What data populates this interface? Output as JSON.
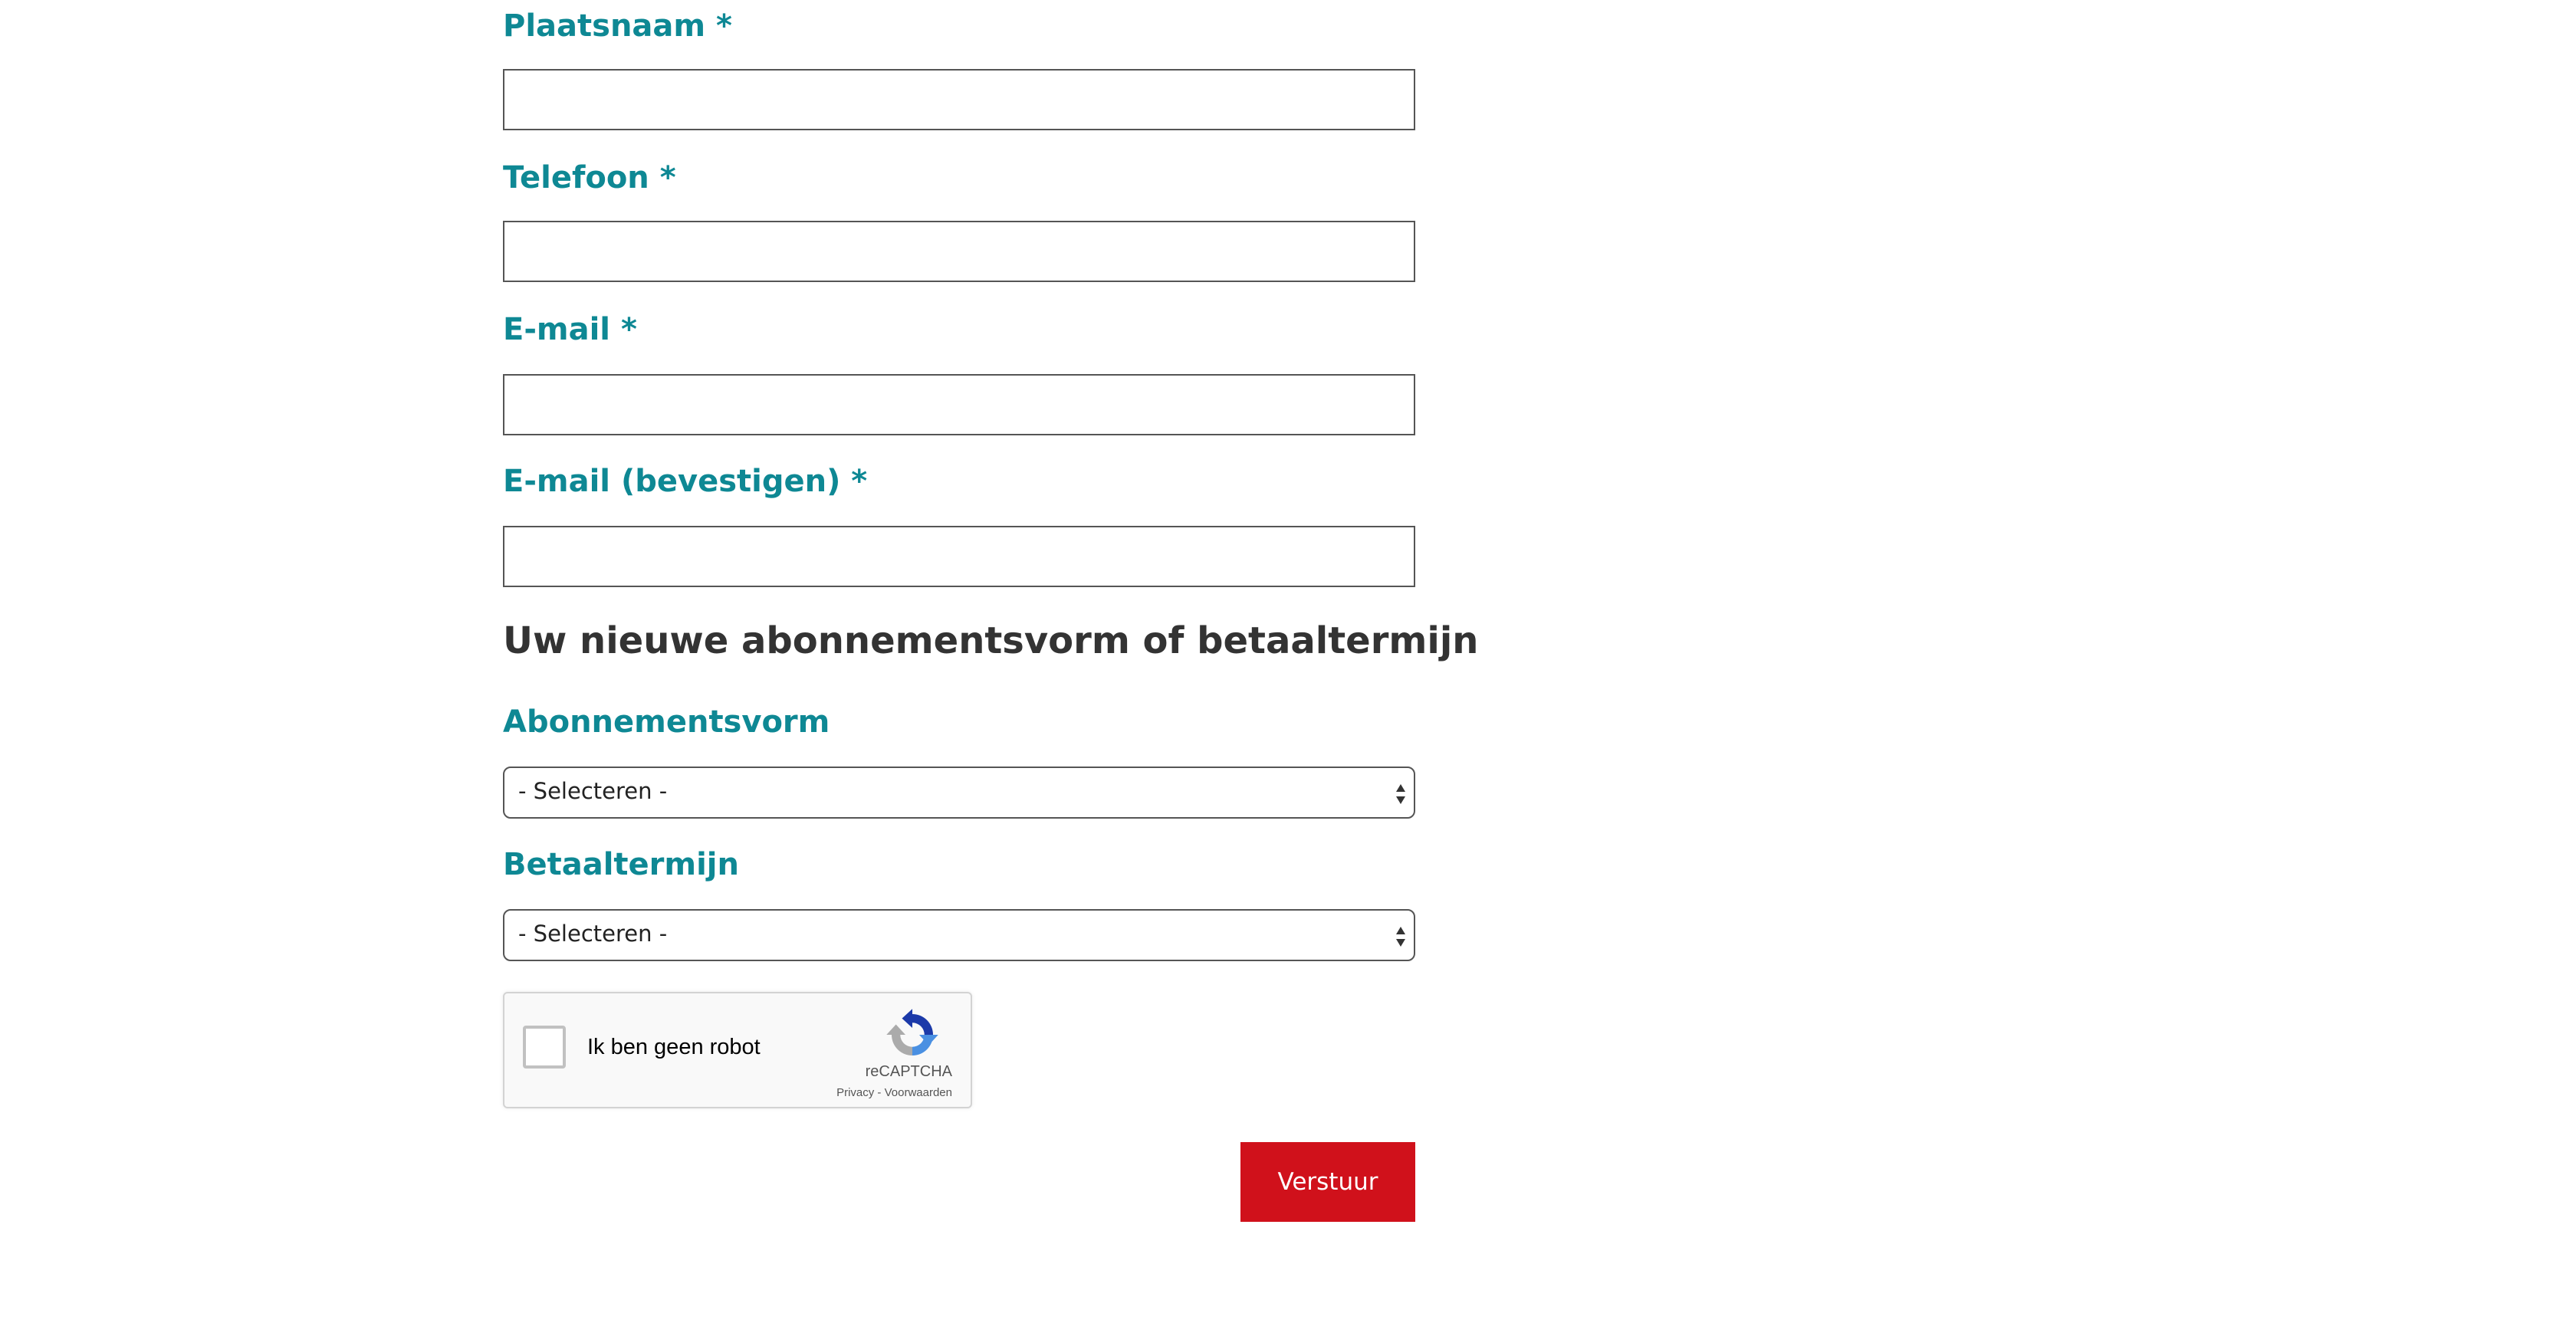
{
  "fields": {
    "city": {
      "label": "Plaatsnaam *",
      "value": ""
    },
    "phone": {
      "label": "Telefoon *",
      "value": ""
    },
    "email": {
      "label": "E-mail *",
      "value": ""
    },
    "email_confirm": {
      "label": "E-mail (bevestigen) *",
      "value": ""
    }
  },
  "subscription_section": {
    "title": "Uw nieuwe abonnementsvorm of betaaltermijn",
    "subscription_type": {
      "label": "Abonnementsvorm",
      "selected": "- Selecteren -"
    },
    "payment_term": {
      "label": "Betaaltermijn",
      "selected": "- Selecteren -"
    }
  },
  "recaptcha": {
    "label": "Ik ben geen robot",
    "brand": "reCAPTCHA",
    "links": "Privacy - Voorwaarden",
    "icon": "recaptcha-logo-icon"
  },
  "submit_label": "Verstuur",
  "colors": {
    "label": "#0e8894",
    "heading": "#333333",
    "submit_bg": "#d0111b",
    "submit_text": "#ffffff"
  }
}
